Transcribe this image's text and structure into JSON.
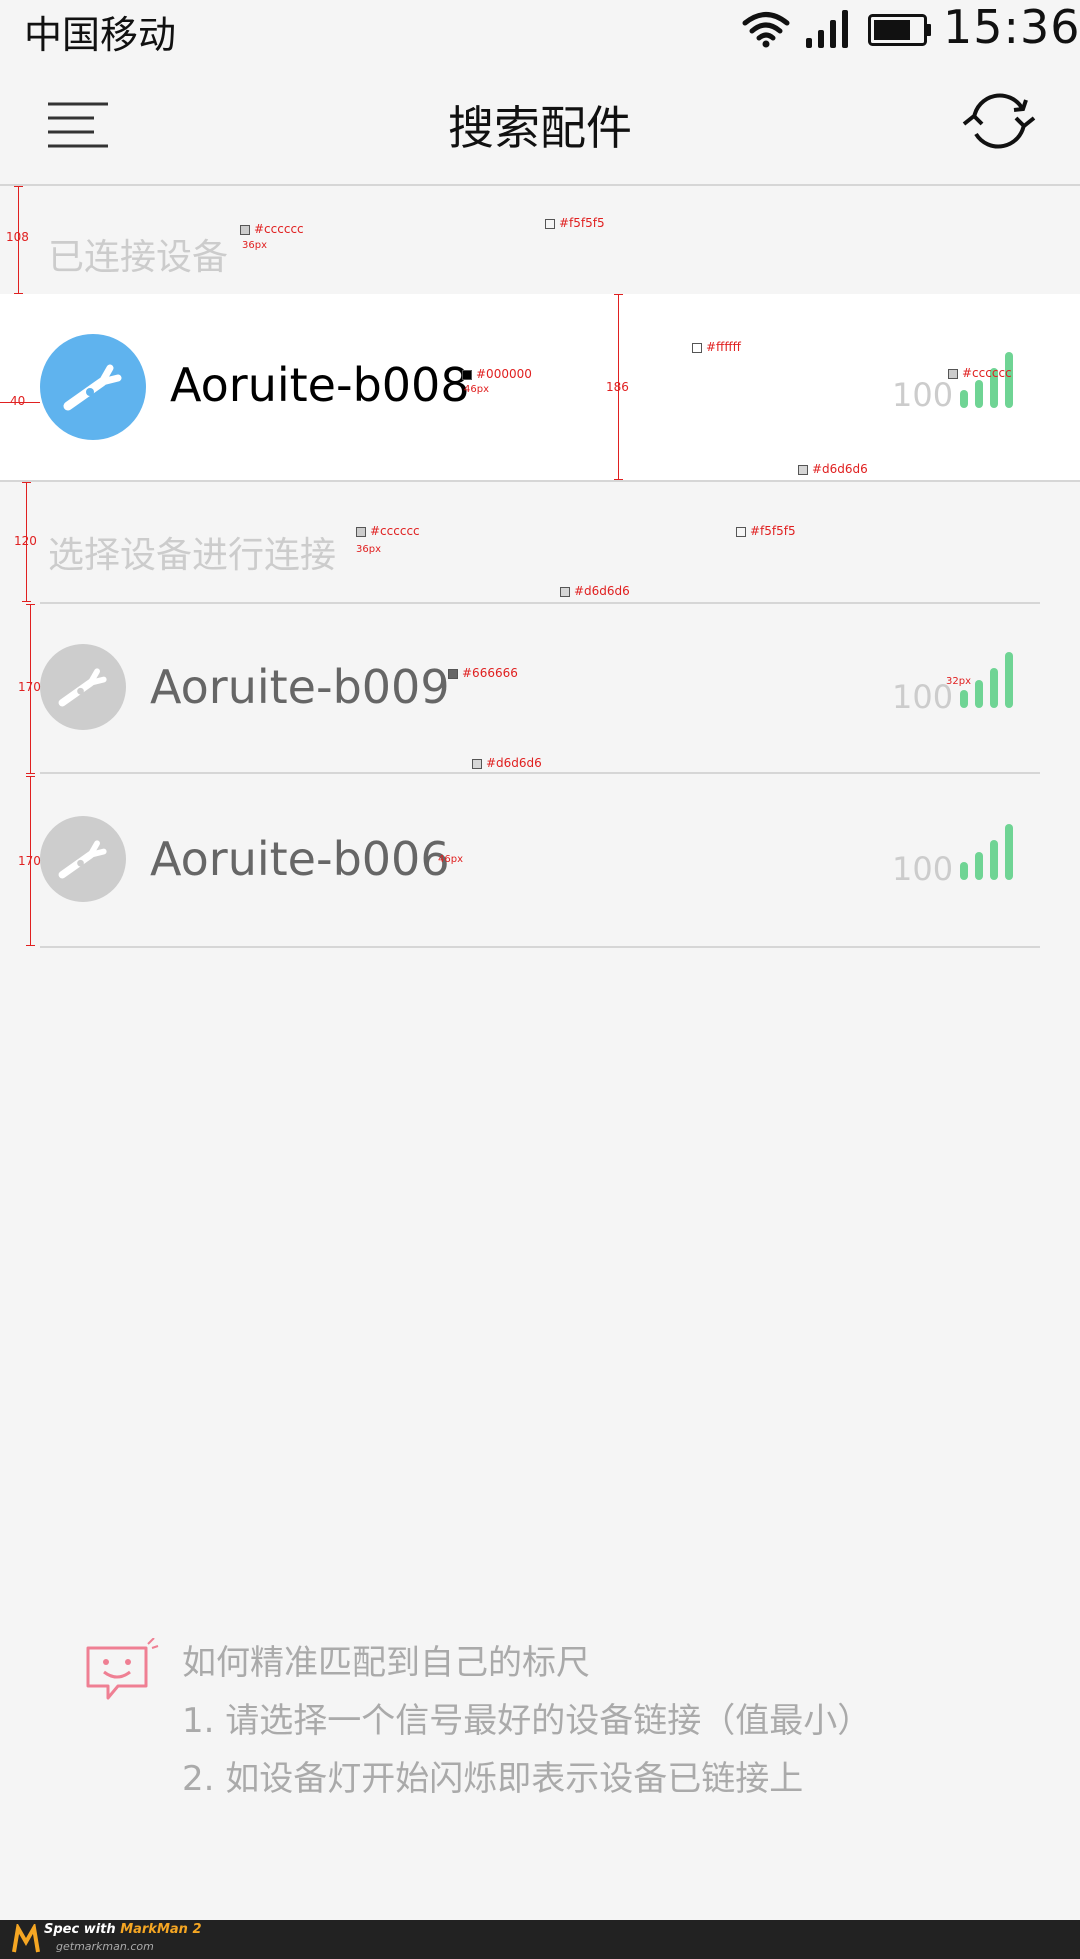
{
  "status_bar": {
    "carrier": "中国移动",
    "time": "15:36",
    "icons": [
      "wifi-icon",
      "cellular-signal-icon",
      "battery-icon"
    ]
  },
  "nav": {
    "title": "搜索配件",
    "left_icon": "menu-icon",
    "right_icon": "refresh-icon"
  },
  "sections": {
    "connected_label": "已连接设备",
    "available_label": "选择设备进行连接"
  },
  "connected_devices": [
    {
      "name": "Aoruite-b008",
      "signal": "100",
      "icon": "flosser-icon"
    }
  ],
  "available_devices": [
    {
      "name": "Aoruite-b009",
      "signal": "100",
      "icon": "flosser-icon"
    },
    {
      "name": "Aoruite-b006",
      "signal": "100",
      "icon": "flosser-icon"
    }
  ],
  "tips": {
    "icon": "chat-smile-icon",
    "title": "如何精准匹配到自己的标尺",
    "line1": "1. 请选择一个信号最好的设备链接（值最小）",
    "line2": "2. 如设备灯开始闪烁即表示设备已链接上"
  },
  "colors": {
    "background": "#f5f5f5",
    "row_background": "#ffffff",
    "divider": "#d6d6d6",
    "muted_text": "#cccccc",
    "device_name_inactive": "#666666",
    "device_name_active": "#000000",
    "avatar_active": "#5fb3ee",
    "avatar_inactive": "#cdcdcd",
    "signal_green": "#6fd494"
  },
  "annotations": {
    "c_cccccc_1": "#cccccc",
    "fs36_1": "36px",
    "c_f5f5f5_1": "#f5f5f5",
    "c_ffffff": "#ffffff",
    "c_000000": "#000000",
    "fs46_1": "46px",
    "c_cccccc_2": "#cccccc",
    "c_d6d6d6_1": "#d6d6d6",
    "c_cccccc_3": "#cccccc",
    "fs36_2": "36px",
    "c_f5f5f5_2": "#f5f5f5",
    "c_d6d6d6_2": "#d6d6d6",
    "c_666666": "#666666",
    "fs32": "32px",
    "c_d6d6d6_3": "#d6d6d6",
    "fs46_2": "46px",
    "m108": "108",
    "m186": "186",
    "m40": "40",
    "m120": "120",
    "m170_1": "170",
    "m170_2": "170"
  },
  "footer": {
    "spec_prefix": "Spec with ",
    "brand": "MarkMan 2",
    "url": "getmarkman.com"
  }
}
